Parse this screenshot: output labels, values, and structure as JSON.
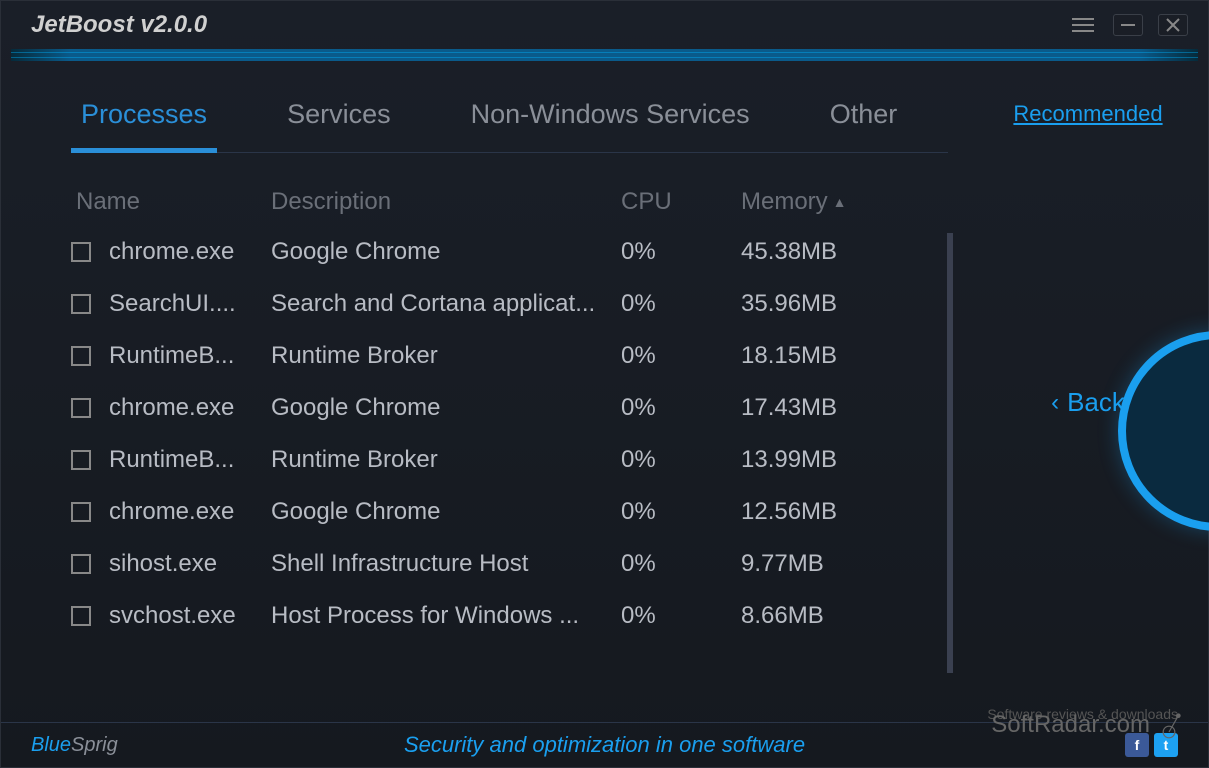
{
  "title": "JetBoost v2.0.0",
  "tabs": [
    "Processes",
    "Services",
    "Non-Windows Services",
    "Other"
  ],
  "activeTab": 0,
  "sidebar": {
    "recommended": "Recommended",
    "back": "Back"
  },
  "columns": {
    "name": "Name",
    "description": "Description",
    "cpu": "CPU",
    "memory": "Memory"
  },
  "rows": [
    {
      "name": "chrome.exe",
      "description": "Google Chrome",
      "cpu": "0%",
      "memory": "45.38MB"
    },
    {
      "name": "SearchUI....",
      "description": "Search and Cortana applicat...",
      "cpu": "0%",
      "memory": "35.96MB"
    },
    {
      "name": "RuntimeB...",
      "description": "Runtime Broker",
      "cpu": "0%",
      "memory": "18.15MB"
    },
    {
      "name": "chrome.exe",
      "description": "Google Chrome",
      "cpu": "0%",
      "memory": "17.43MB"
    },
    {
      "name": "RuntimeB...",
      "description": "Runtime Broker",
      "cpu": "0%",
      "memory": "13.99MB"
    },
    {
      "name": "chrome.exe",
      "description": "Google Chrome",
      "cpu": "0%",
      "memory": "12.56MB"
    },
    {
      "name": "sihost.exe",
      "description": "Shell Infrastructure Host",
      "cpu": "0%",
      "memory": "9.77MB"
    },
    {
      "name": "svchost.exe",
      "description": "Host Process for Windows ...",
      "cpu": "0%",
      "memory": "8.66MB"
    }
  ],
  "footer": {
    "brandPrefix": "Blue",
    "brandSuffix": "Sprig",
    "tagline": "Security and optimization in one software"
  },
  "watermark": {
    "text": "SoftRadar.com",
    "sub": "Software reviews & downloads"
  }
}
